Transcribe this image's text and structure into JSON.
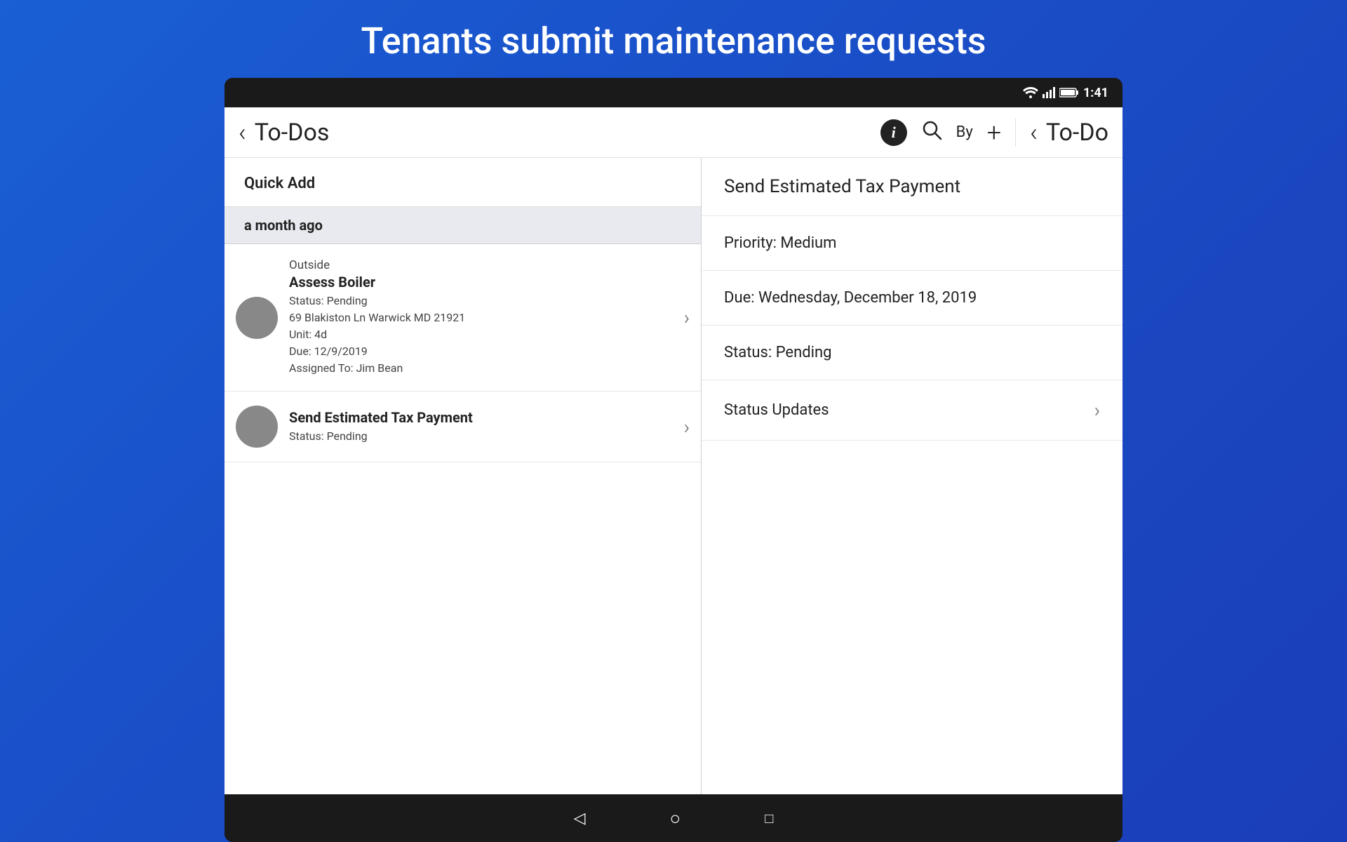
{
  "header": {
    "title": "Tenants submit maintenance requests"
  },
  "statusBar": {
    "time": "1:41",
    "icons": [
      "wifi",
      "signal",
      "battery"
    ]
  },
  "toolbar": {
    "backIcon": "‹",
    "title": "To-Dos",
    "infoIcon": "i",
    "searchIcon": "🔍",
    "byLabel": "By",
    "plusIcon": "+",
    "backIcon2": "‹",
    "todoSectionTitle": "To-Do"
  },
  "leftPanel": {
    "quickAddLabel": "Quick Add",
    "timeSectionLabel": "a month ago",
    "items": [
      {
        "location": "Outside",
        "title": "Assess Boiler",
        "status": "Status: Pending",
        "address": "69 Blakiston Ln Warwick MD 21921",
        "unit": "Unit: 4d",
        "due": "Due: 12/9/2019",
        "assignedTo": "Assigned To: Jim Bean"
      },
      {
        "title": "Send Estimated Tax Payment",
        "status": "Status: Pending"
      }
    ]
  },
  "rightPanel": {
    "title": "Send Estimated Tax Payment",
    "priority": "Priority: Medium",
    "due": "Due: Wednesday, December 18, 2019",
    "status": "Status: Pending",
    "statusUpdates": "Status Updates"
  },
  "bottomNav": {
    "backLabel": "◁",
    "homeLabel": "○",
    "recentLabel": "□"
  }
}
